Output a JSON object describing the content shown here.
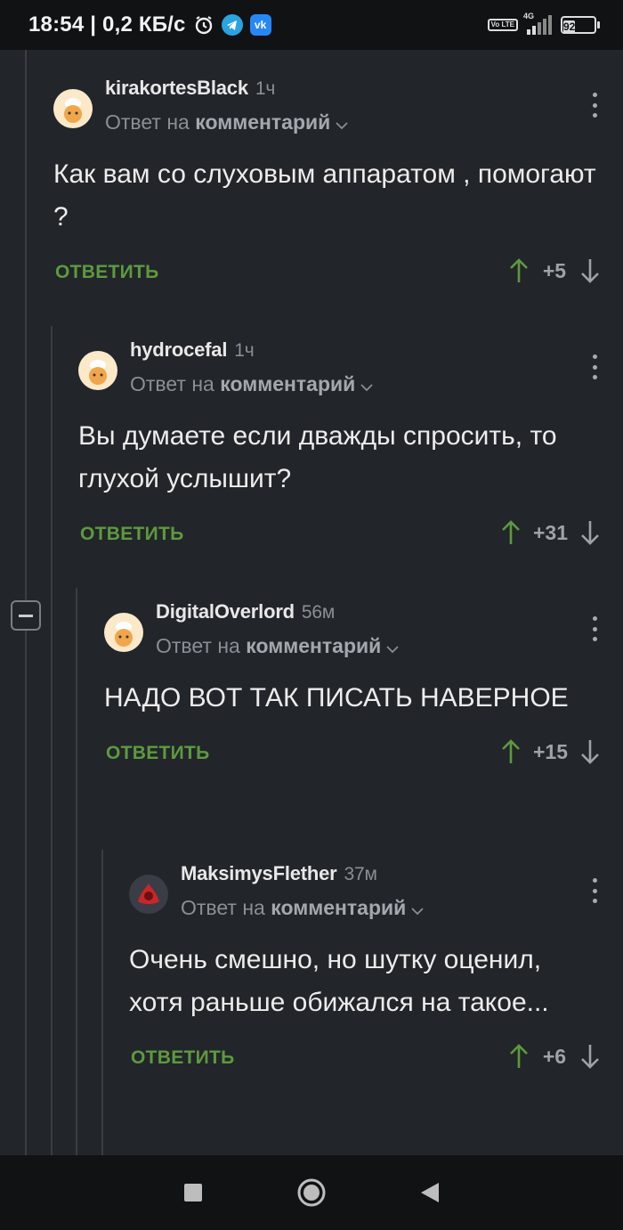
{
  "status_bar": {
    "time_net": "18:54 | 0,2 КБ/с",
    "network_type": "4G",
    "volte": "Vo LTE",
    "battery": "92",
    "battery_level_percent": 92,
    "vk_label": "vk",
    "icons": [
      "alarm-icon",
      "telegram-icon",
      "vk-icon",
      "volte-icon",
      "signal-icon",
      "battery-icon"
    ]
  },
  "comments": [
    {
      "username": "kirakortesBlack",
      "time": "1ч",
      "reply_prefix": "Ответ на",
      "reply_target": "комментарий",
      "text": "Как вам со слуховым аппаратом , помогают ?",
      "reply_label": "ОТВЕТИТЬ",
      "score": "+5"
    },
    {
      "username": "hydrocefal",
      "time": "1ч",
      "reply_prefix": "Ответ на",
      "reply_target": "комментарий",
      "text": "Вы думаете если дважды спросить, то глухой услышит?",
      "reply_label": "ОТВЕТИТЬ",
      "score": "+31"
    },
    {
      "username": "DigitalOverlord",
      "time": "56м",
      "reply_prefix": "Ответ на",
      "reply_target": "комментарий",
      "text": "НАДО ВОТ ТАК ПИСАТЬ НАВЕРНОЕ",
      "reply_label": "ОТВЕТИТЬ",
      "score": "+15"
    },
    {
      "username": "MaksimysFlether",
      "time": "37м",
      "reply_prefix": "Ответ на",
      "reply_target": "комментарий",
      "text": "Очень смешно, но шутку оценил, хотя раньше обижался на такое...",
      "reply_label": "ОТВЕТИТЬ",
      "score": "+6"
    }
  ],
  "colors": {
    "background": "#22252a",
    "reply_green": "#5d9a3e",
    "upvote_green": "#5d9a3e",
    "muted": "#8a8f96"
  },
  "navbar": {
    "icons": [
      "recent-apps-icon",
      "home-icon",
      "back-icon"
    ]
  }
}
